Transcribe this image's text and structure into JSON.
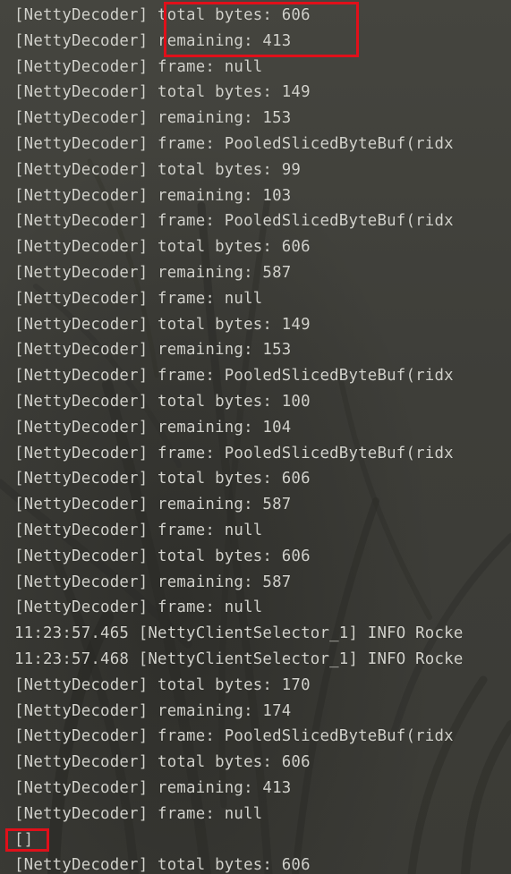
{
  "console": {
    "lines": [
      "[NettyDecoder] total bytes: 606",
      "[NettyDecoder] remaining: 413",
      "[NettyDecoder] frame: null",
      "[NettyDecoder] total bytes: 149",
      "[NettyDecoder] remaining: 153",
      "[NettyDecoder] frame: PooledSlicedByteBuf(ridx",
      "[NettyDecoder] total bytes: 99",
      "[NettyDecoder] remaining: 103",
      "[NettyDecoder] frame: PooledSlicedByteBuf(ridx",
      "[NettyDecoder] total bytes: 606",
      "[NettyDecoder] remaining: 587",
      "[NettyDecoder] frame: null",
      "[NettyDecoder] total bytes: 149",
      "[NettyDecoder] remaining: 153",
      "[NettyDecoder] frame: PooledSlicedByteBuf(ridx",
      "[NettyDecoder] total bytes: 100",
      "[NettyDecoder] remaining: 104",
      "[NettyDecoder] frame: PooledSlicedByteBuf(ridx",
      "[NettyDecoder] total bytes: 606",
      "[NettyDecoder] remaining: 587",
      "[NettyDecoder] frame: null",
      "[NettyDecoder] total bytes: 606",
      "[NettyDecoder] remaining: 587",
      "[NettyDecoder] frame: null",
      "11:23:57.465 [NettyClientSelector_1] INFO Rocke",
      "11:23:57.468 [NettyClientSelector_1] INFO Rocke",
      "[NettyDecoder] total bytes: 170",
      "[NettyDecoder] remaining: 174",
      "[NettyDecoder] frame: PooledSlicedByteBuf(ridx",
      "[NettyDecoder] total bytes: 606",
      "[NettyDecoder] remaining: 413",
      "[NettyDecoder] frame: null",
      "[]",
      "[NettyDecoder] total bytes: 606"
    ]
  },
  "colors": {
    "text": "#d2d2cc",
    "background": "#3f3f3a",
    "highlight": "#e0101a"
  }
}
